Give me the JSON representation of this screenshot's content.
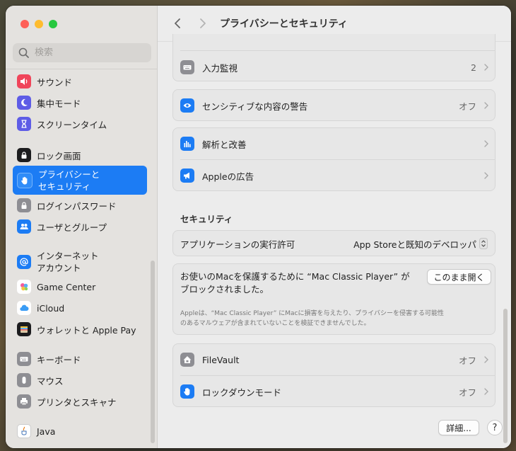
{
  "sidebar": {
    "search_placeholder": "検索",
    "items": [
      {
        "label": "サウンド",
        "icon": "speaker-icon",
        "color": "#f0455a"
      },
      {
        "label": "集中モード",
        "icon": "moon-icon",
        "color": "#5e5ce6"
      },
      {
        "label": "スクリーンタイム",
        "icon": "hourglass-icon",
        "color": "#5e5ce6"
      },
      {
        "label": "ロック画面",
        "icon": "lock-screen-icon",
        "color": "#1c1c1e"
      },
      {
        "label_line1": "プライバシーと",
        "label_line2": "セキュリティ",
        "icon": "hand-icon",
        "color": "#1c7cf4"
      },
      {
        "label": "ログインパスワード",
        "icon": "lock-icon",
        "color": "#8e8e93"
      },
      {
        "label": "ユーザとグループ",
        "icon": "users-icon",
        "color": "#1c7cf4"
      },
      {
        "label_line1": "インターネット",
        "label_line2": "アカウント",
        "icon": "at-icon",
        "color": "#1c7cf4"
      },
      {
        "label": "Game Center",
        "icon": "game-center-icon",
        "color": "#ffffff"
      },
      {
        "label": "iCloud",
        "icon": "cloud-icon",
        "color": "#ffffff"
      },
      {
        "label": "ウォレットと Apple Pay",
        "icon": "wallet-icon",
        "color": "#1c1c1e"
      },
      {
        "label": "キーボード",
        "icon": "keyboard-icon",
        "color": "#8e8e93"
      },
      {
        "label": "マウス",
        "icon": "mouse-icon",
        "color": "#8e8e93"
      },
      {
        "label": "プリンタとスキャナ",
        "icon": "printer-icon",
        "color": "#8e8e93"
      },
      {
        "label": "Java",
        "icon": "java-icon",
        "color": "#ffffff"
      }
    ]
  },
  "header": {
    "title": "プライバシーとセキュリティ"
  },
  "privacy": {
    "input_monitoring": {
      "label": "入力監視",
      "value": "2"
    },
    "sensitive_content": {
      "label": "センシティブな内容の警告",
      "value": "オフ"
    },
    "analytics": {
      "label": "解析と改善"
    },
    "apple_ads": {
      "label": "Appleの広告"
    }
  },
  "security": {
    "heading": "セキュリティ",
    "app_permission_label": "アプリケーションの実行許可",
    "app_permission_value": "App Storeと既知のデベロッパ",
    "blocked_line1": "お使いのMacを保護するために “Mac Classic Player” が",
    "blocked_line2": "ブロックされました。",
    "open_anyway": "このまま開く",
    "blocked_detail_line1": "Appleは、“Mac Classic Player” にMacに損害を与えたり、プライバシーを侵害する可能性",
    "blocked_detail_line2": "のあるマルウェアが含まれていないことを検証できませんでした。",
    "filevault": {
      "label": "FileVault",
      "value": "オフ"
    },
    "lockdown": {
      "label": "ロックダウンモード",
      "value": "オフ"
    }
  },
  "footer": {
    "details_button": "詳細...",
    "help_button": "?"
  },
  "colors": {
    "accent": "#1c7cf4",
    "close": "#fe5f57",
    "minimize": "#febc2e",
    "zoom": "#28c840"
  }
}
